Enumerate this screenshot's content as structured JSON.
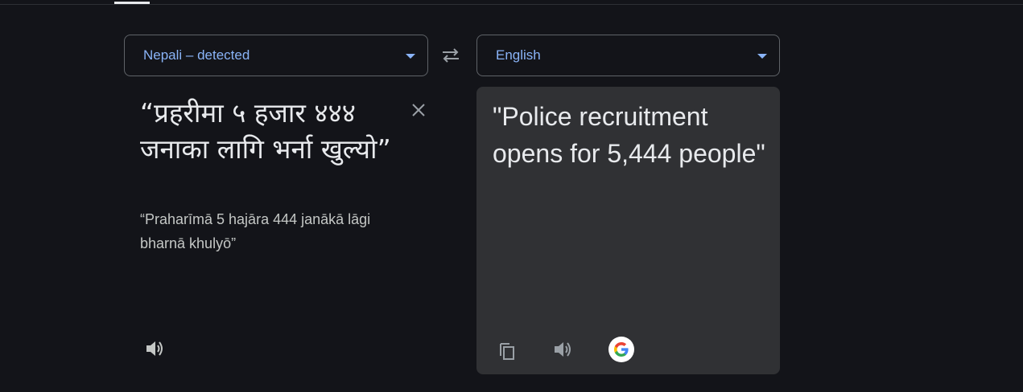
{
  "source": {
    "language_label": "Nepali – detected",
    "text": "“प्रहरीमा ५ हजार ४४४ जनाका लागि भर्ना खुल्यो”",
    "transliteration": "“Praharīmā 5 hajāra 444 janākā lāgi bharnā khulyō”",
    "icons": {
      "clear": "close-icon",
      "listen": "volume-icon"
    }
  },
  "target": {
    "language_label": "English",
    "text": "\"Police recruitment opens for 5,444 people\"",
    "icons": {
      "copy": "copy-icon",
      "listen": "volume-icon",
      "google": "google-logo-icon"
    }
  },
  "swap_icon": "swap-arrows-icon",
  "colors": {
    "background": "#131419",
    "accent": "#8ab4f8",
    "panel": "#303134",
    "text": "#e8eaed",
    "muted": "#c4c7c5",
    "icon": "#9aa0a6"
  }
}
